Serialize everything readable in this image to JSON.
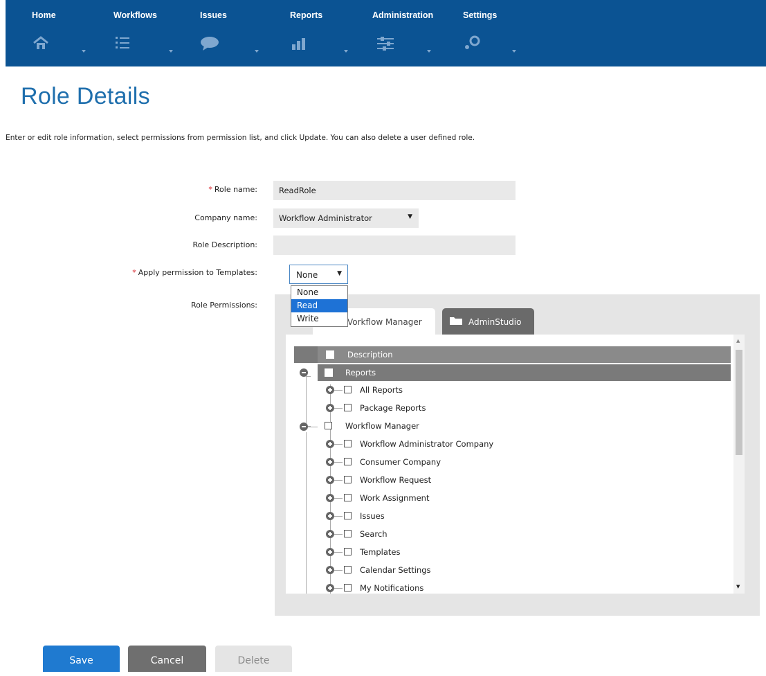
{
  "nav": {
    "items": [
      {
        "label": "Home",
        "icon": "home-icon"
      },
      {
        "label": "Workflows",
        "icon": "list-icon"
      },
      {
        "label": "Issues",
        "icon": "speech-bubble-icon"
      },
      {
        "label": "Reports",
        "icon": "bar-chart-icon"
      },
      {
        "label": "Administration",
        "icon": "sliders-icon"
      },
      {
        "label": "Settings",
        "icon": "gears-icon"
      }
    ],
    "background": "#0b5393"
  },
  "page": {
    "title": "Role Details",
    "intro": "Enter or edit role information, select permissions from permission list, and click Update. You can also delete a user defined role."
  },
  "form": {
    "role_name_label": "Role name:",
    "role_name_value": "ReadRole",
    "company_name_label": "Company name:",
    "company_name_value": "Workflow Administrator",
    "role_description_label": "Role Description:",
    "role_description_value": "",
    "apply_templates_label": "Apply permission to Templates:",
    "apply_templates_value": "None",
    "apply_templates_options": [
      "None",
      "Read",
      "Write"
    ],
    "apply_templates_highlighted": "Read",
    "role_permissions_label": "Role Permissions:",
    "required_mark": "*"
  },
  "permissions": {
    "tabs": [
      {
        "label": "Workflow Manager",
        "visible_label": "Vorkflow Manager",
        "active": true
      },
      {
        "label": "AdminStudio",
        "active": false
      }
    ],
    "header": "Description",
    "tree": [
      {
        "label": "Reports",
        "level": 0,
        "expanded": true,
        "highlighted": true
      },
      {
        "label": "All Reports",
        "level": 1
      },
      {
        "label": "Package Reports",
        "level": 1
      },
      {
        "label": "Workflow Manager",
        "level": 0,
        "expanded": true
      },
      {
        "label": "Workflow Administrator Company",
        "level": 1
      },
      {
        "label": "Consumer Company",
        "level": 1
      },
      {
        "label": "Workflow Request",
        "level": 1
      },
      {
        "label": "Work Assignment",
        "level": 1
      },
      {
        "label": "Issues",
        "level": 1
      },
      {
        "label": "Search",
        "level": 1
      },
      {
        "label": "Templates",
        "level": 1
      },
      {
        "label": "Calendar Settings",
        "level": 1
      },
      {
        "label": "My Notifications",
        "level": 1
      }
    ]
  },
  "buttons": {
    "save": "Save",
    "cancel": "Cancel",
    "delete": "Delete"
  },
  "colors": {
    "title": "#1f6fad",
    "primary_button": "#1f7ad0",
    "dropdown_highlight": "#1e72d6"
  }
}
